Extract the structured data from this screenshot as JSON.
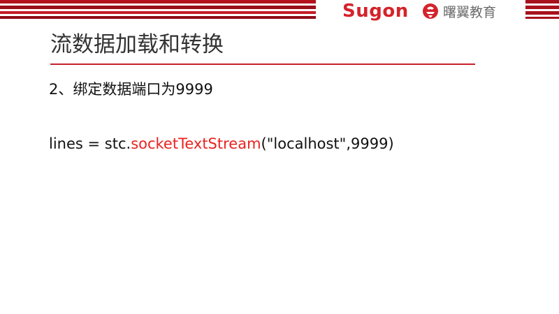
{
  "header": {
    "brand_name": "Sugon",
    "brand_color": "#d4232b",
    "partner_name": "曙翼教育",
    "emblem_icon": "sugon-emblem-icon",
    "stripe_color": "#b3121e"
  },
  "slide": {
    "title": "流数据加载和转换",
    "point": "2、绑定数据端口为9999",
    "code": {
      "prefix": "lines = stc.",
      "method": "socketTextStream",
      "suffix": "(\"localhost\",9999)",
      "method_color": "#e8231f"
    },
    "accent_color": "#c8202a"
  }
}
